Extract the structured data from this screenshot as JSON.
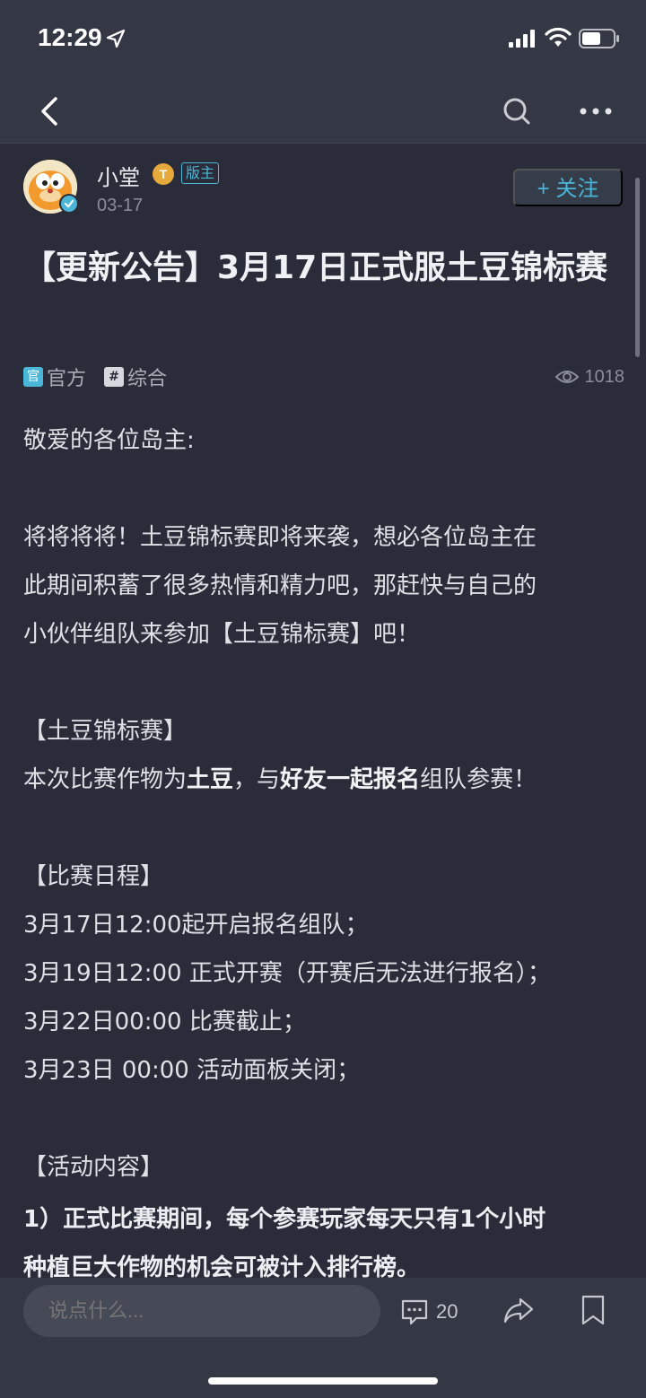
{
  "status_bar": {
    "time": "12:29",
    "icons": [
      "location-arrow-icon",
      "signal-icon",
      "wifi-icon",
      "battery-icon"
    ]
  },
  "nav": {
    "icons": [
      "back-chevron-icon",
      "search-icon",
      "more-dots-icon"
    ]
  },
  "author": {
    "name": "小堂",
    "level_badge": "T",
    "role_badge": "版主",
    "date": "03-17",
    "follow_label": "+ 关注"
  },
  "post": {
    "title": "【更新公告】3月17日正式服土豆锦标赛",
    "tags": [
      {
        "icon_text": "官",
        "label": "官方",
        "icon_color": "#4ab7d8"
      },
      {
        "icon_text": "#",
        "label": "综合",
        "icon_color": "#d6d8dd"
      }
    ],
    "views": "1018"
  },
  "content": {
    "greeting": "敬爱的各位岛主:",
    "p1_l1": "将将将将！土豆锦标赛即将来袭，想必各位岛主在",
    "p1_l2": "此期间积蓄了很多热情和精力吧，那赶快与自己的",
    "p1_l3": "小伙伴组队来参加【土豆锦标赛】吧！",
    "h1": "【土豆锦标赛】",
    "p2_a": "本次比赛作物为",
    "p2_b": "土豆",
    "p2_c": "，与",
    "p2_d": "好友一起报名",
    "p2_e": "组队参赛！",
    "h2": "【比赛日程】",
    "s1": "3月17日12:00起开启报名组队；",
    "s2": "3月19日12:00 正式开赛（开赛后无法进行报名）；",
    "s3": "3月22日00:00 比赛截止；",
    "s4": "3月23日 00:00 活动面板关闭；",
    "h3": "【活动内容】",
    "r1_l1": "1）正式比赛期间，每个参赛玩家每天只有1个小时",
    "r1_l2": "种植巨大作物的机会可被计入排行榜。"
  },
  "bottom": {
    "comment_placeholder": "说点什么...",
    "comment_count": "20"
  },
  "colors": {
    "background": "#2a2d39",
    "bar": "#343844",
    "accent": "#4ab7d8"
  }
}
